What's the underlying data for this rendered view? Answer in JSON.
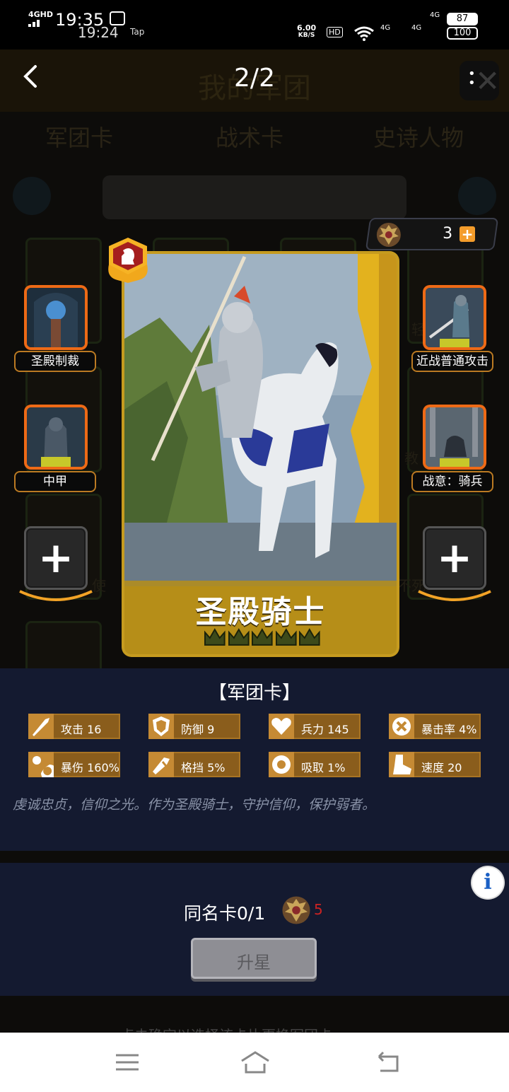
{
  "status_bar": {
    "network_type": "4GHD",
    "time_primary": "19:35",
    "time_secondary": "19:24",
    "tap_label": "Tap",
    "speed_value": "6.00",
    "speed_unit": "KB/S",
    "hd_label": "HD",
    "sim1_label": "4G",
    "sim2_label": "4G",
    "sim0_label": "4G",
    "battery_1": "87",
    "battery_2": "100"
  },
  "background": {
    "title": "我的军团",
    "tabs": [
      "军团卡",
      "战术卡",
      "史诗人物"
    ],
    "faint_text_1": "轻",
    "faint_text_2": "教",
    "faint_text_3": "使",
    "faint_text_4": "不死",
    "bottom_faint": "点击确定以选择该卡片更换军团卡"
  },
  "header": {
    "pager": "2/2"
  },
  "currency": {
    "amount": "3",
    "plus": "+"
  },
  "card": {
    "name": "圣殿骑士",
    "star_count": 5,
    "rank_icon": "knight-chess-badge"
  },
  "skills": {
    "left_1": "圣殿制裁",
    "left_2": "中甲",
    "right_1": "近战普通攻击",
    "right_2": "战意：骑兵",
    "add": "+"
  },
  "panel": {
    "title": "【军团卡】",
    "stats": [
      {
        "label": "攻击 16",
        "icon": "sword-icon"
      },
      {
        "label": "防御 9",
        "icon": "shield-icon"
      },
      {
        "label": "兵力 145",
        "icon": "heart-icon"
      },
      {
        "label": "暴击率 4%",
        "icon": "crit-icon"
      },
      {
        "label": "暴伤 160%",
        "icon": "crit-damage-icon"
      },
      {
        "label": "格挡 5%",
        "icon": "block-icon"
      },
      {
        "label": "吸取 1%",
        "icon": "lifesteal-icon"
      },
      {
        "label": "速度 20",
        "icon": "boot-icon"
      }
    ],
    "description": "虔诚忠贞，信仰之光。作为圣殿骑士，守护信仰，保护弱者。"
  },
  "upgrade": {
    "info": "i",
    "dup_label": "同名卡0/1",
    "cost": "5",
    "button": "升星"
  },
  "colors": {
    "accent_orange": "#ee6a16",
    "card_gold": "#c69b1f",
    "panel_navy": "#141a30",
    "stat_bronze": "#8a5d1c"
  }
}
